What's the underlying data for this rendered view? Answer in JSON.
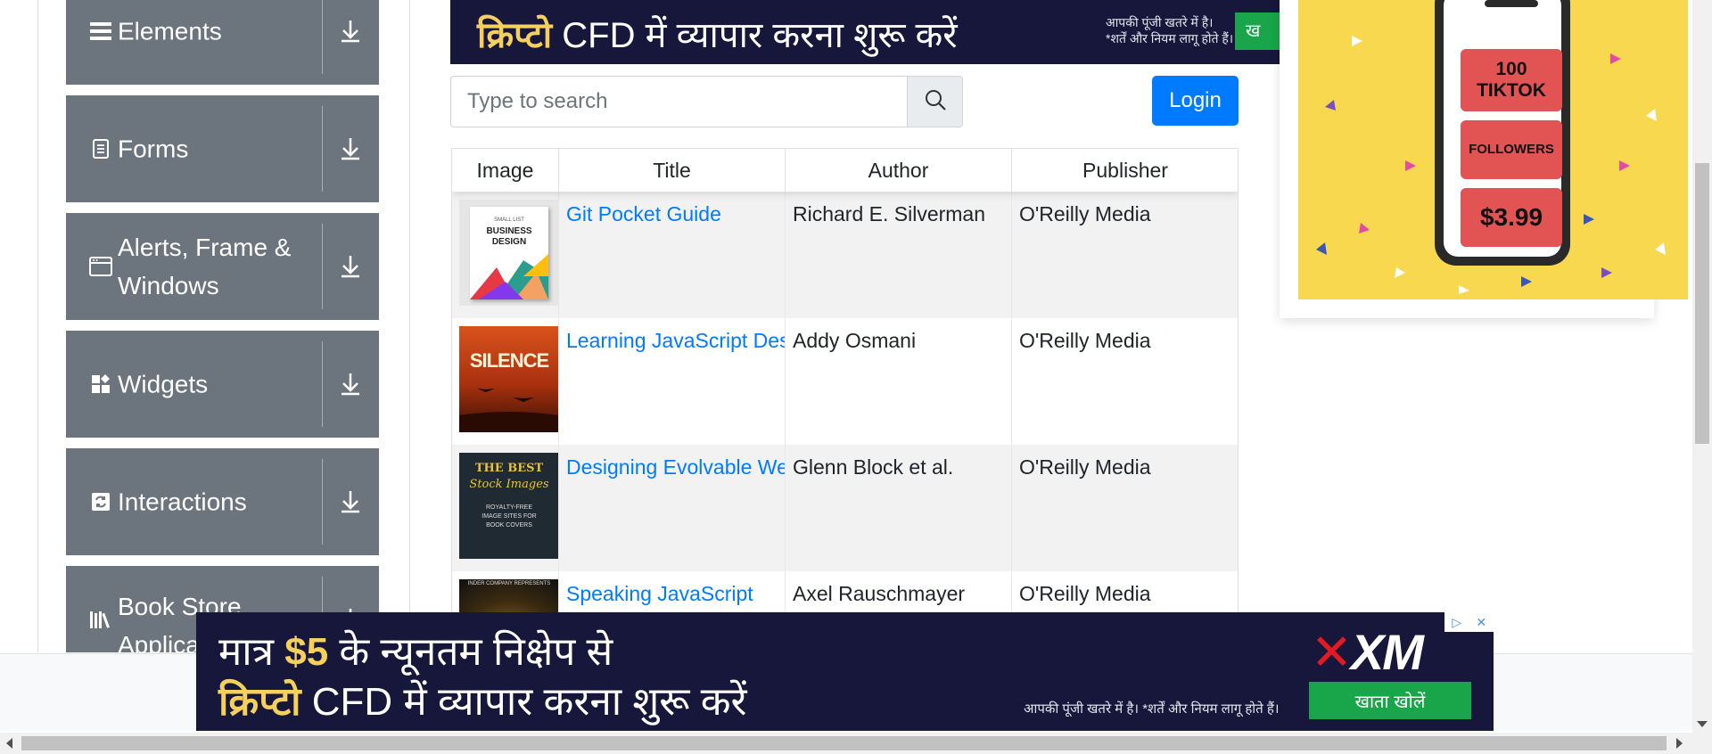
{
  "sidebar": {
    "groups": [
      {
        "label": "Elements",
        "icon": "hamburger-icon"
      },
      {
        "label": "Forms",
        "icon": "form-icon"
      },
      {
        "label": "Alerts, Frame & Windows",
        "icon": "window-icon"
      },
      {
        "label": "Widgets",
        "icon": "widgets-icon"
      },
      {
        "label": "Interactions",
        "icon": "interactions-icon"
      },
      {
        "label": "Book Store Application",
        "icon": "books-icon"
      }
    ]
  },
  "top_ad": {
    "headline_bold": "क्रिप्टो",
    "headline_rest": "CFD में व्यापार करना शुरू करें",
    "disclaimer_line1": "आपकी पूंजी खतरे में है।",
    "disclaimer_line2": "*शर्तें और नियम लागू होते हैं।",
    "button_fragment": "ख"
  },
  "search": {
    "placeholder": "Type to search",
    "value": ""
  },
  "login_label": "Login",
  "table": {
    "headers": [
      "Image",
      "Title",
      "Author",
      "Publisher"
    ],
    "rows": [
      {
        "title": "Git Pocket Guide",
        "author": "Richard E. Silverman",
        "publisher": "O'Reilly Media"
      },
      {
        "title": "Learning JavaScript Design Patterns",
        "author": "Addy Osmani",
        "publisher": "O'Reilly Media"
      },
      {
        "title": "Designing Evolvable Web APIs with ASP.NET",
        "author": "Glenn Block et al.",
        "publisher": "O'Reilly Media"
      },
      {
        "title": "Speaking JavaScript",
        "author": "Axel Rauschmayer",
        "publisher": "O'Reilly Media"
      }
    ],
    "covers": [
      {
        "line1": "SMALL LIST",
        "line2": "BUSINESS",
        "line3": "DESIGN"
      },
      {
        "line1": "SILENCE"
      },
      {
        "line1": "THE BEST",
        "line2": "Stock Images",
        "line3": "ROYALTY-FREE",
        "line4": "IMAGE SITES FOR",
        "line5": "BOOK COVERS"
      },
      {
        "line1": "INDER COMPANY REPRESENTS"
      }
    ]
  },
  "right_ad": {
    "box1": "100 TIKTOK",
    "box2": "FOLLOWERS",
    "box3": "$3.99"
  },
  "bottom_ad": {
    "line1_pre": "मात्र ",
    "line1_bold": "$5",
    "line1_post": " के न्यूनतम निक्षेप से",
    "line2_bold": "क्रिप्टो",
    "line2_rest": " CFD में  व्यापार करना शुरू करें",
    "disclaimer": "आपकी पूंजी खतरे में है। *शर्तें और नियम लागू होते हैं।",
    "logo_text": "XM",
    "button": "खाता खोलें",
    "adchoices_icon": "adchoices-icon",
    "close_glyph": "✕"
  },
  "colors": {
    "sidebar_group": "#6c757d",
    "primary": "#007bff",
    "ad_navy": "#16173a",
    "ad_green": "#19a54a",
    "ad_yellow": "#f7d84f"
  }
}
